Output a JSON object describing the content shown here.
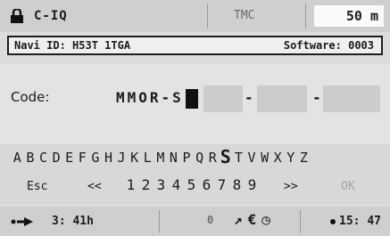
{
  "topbar": {
    "title": "C-IQ",
    "tmc": "TMC",
    "distance": "50 m"
  },
  "navi": {
    "id_label": "Navi ID: H53T 1TGA",
    "software_label": "Software: 0003"
  },
  "code": {
    "label": "Code:",
    "entered": "MMOR-S",
    "separators": [
      "-",
      "-"
    ]
  },
  "keyboard": {
    "letters": [
      "A",
      "B",
      "C",
      "D",
      "E",
      "F",
      "G",
      "H",
      "J",
      "K",
      "L",
      "M",
      "N",
      "P",
      "Q",
      "R",
      "S",
      "T",
      "V",
      "W",
      "X",
      "Y",
      "Z"
    ],
    "selected": "S",
    "esc": "Esc",
    "back": "<<",
    "digits": [
      "1",
      "2",
      "3",
      "4",
      "5",
      "6",
      "7",
      "8",
      "9"
    ],
    "forward": ">>",
    "ok": "OK"
  },
  "statusbar": {
    "eta": "3: 41h",
    "mid": "0",
    "clock": "15: 47"
  }
}
